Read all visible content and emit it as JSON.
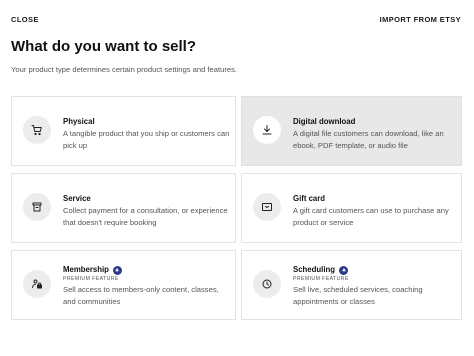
{
  "header": {
    "close_label": "CLOSE",
    "import_label": "IMPORT FROM ETSY"
  },
  "page": {
    "title": "What do you want to sell?",
    "subtitle": "Your product type determines certain product settings and features."
  },
  "colors": {
    "selected_card_bg": "#e8e8e8",
    "premium_badge": "#2b3a8a"
  },
  "product_types": [
    {
      "title": "Physical",
      "description": "A tangible product that you ship or customers can pick up",
      "icon": "cart-icon",
      "selected": false
    },
    {
      "title": "Digital download",
      "description": "A digital file customers can download, like an ebook, PDF template, or audio file",
      "icon": "download-icon",
      "selected": true
    },
    {
      "title": "Service",
      "description": "Collect payment for a consultation, or experience that doesn't require booking",
      "icon": "service-icon",
      "selected": false
    },
    {
      "title": "Gift card",
      "description": "A gift card customers can use to purchase any product or service",
      "icon": "gift-card-icon",
      "selected": false
    },
    {
      "title": "Membership",
      "premium_label": "PREMIUM FEATURE",
      "description": "Sell access to members-only content, classes, and communities",
      "icon": "membership-lock-icon",
      "selected": false
    },
    {
      "title": "Scheduling",
      "premium_label": "PREMIUM FEATURE",
      "description": "Sell live, scheduled services, coaching appointments or classes",
      "icon": "clock-icon",
      "selected": false
    }
  ]
}
